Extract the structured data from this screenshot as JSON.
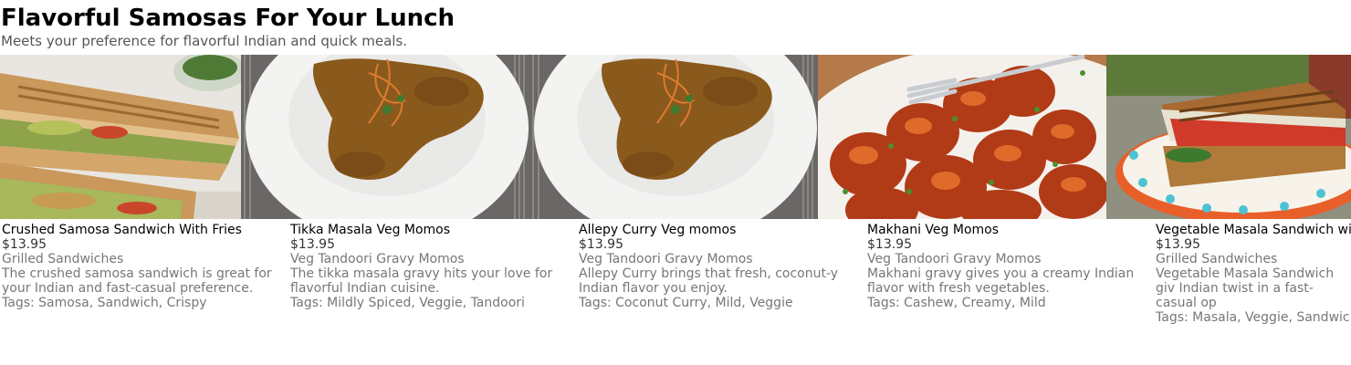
{
  "page": {
    "title": "Flavorful Samosas For Your Lunch",
    "subtitle": "Meets your preference for flavorful Indian and quick meals."
  },
  "items": [
    {
      "name": "Crushed Samosa Sandwich With Fries",
      "price": "$13.95",
      "category": "Grilled Sandwiches",
      "description": "The crushed samosa sandwich is great for your Indian and fast-casual preference.",
      "tags": "Tags: Samosa, Sandwich, Crispy",
      "image": "grilled-sandwich-photo"
    },
    {
      "name": "Tikka Masala Veg Momos",
      "price": "$13.95",
      "category": "Veg Tandoori Gravy Momos",
      "description": "The tikka masala gravy hits your love for flavorful Indian cuisine.",
      "tags": "Tags: Mildly Spiced, Veggie, Tandoori",
      "image": "gravy-momos-plate-photo"
    },
    {
      "name": "Allepy Curry Veg momos",
      "price": "$13.95",
      "category": "Veg Tandoori Gravy Momos",
      "description": "Allepy Curry brings that fresh, coconut-y Indian flavor you enjoy.",
      "tags": "Tags: Coconut Curry, Mild, Veggie",
      "image": "gravy-momos-plate-photo"
    },
    {
      "name": "Makhani Veg Momos",
      "price": "$13.95",
      "category": "Veg Tandoori Gravy Momos",
      "description": "Makhani gravy gives you a creamy Indian flavor with fresh vegetables.",
      "tags": "Tags: Cashew, Creamy, Mild",
      "image": "saucy-momos-photo"
    },
    {
      "name": "Vegetable Masala Sandwich wi",
      "price": "$13.95",
      "category": "Grilled Sandwiches",
      "description": "Vegetable Masala Sandwich giv Indian twist in a fast-casual op",
      "tags": "Tags: Masala, Veggie, Sandwic",
      "image": "grilled-sandwich-plate-photo"
    }
  ]
}
